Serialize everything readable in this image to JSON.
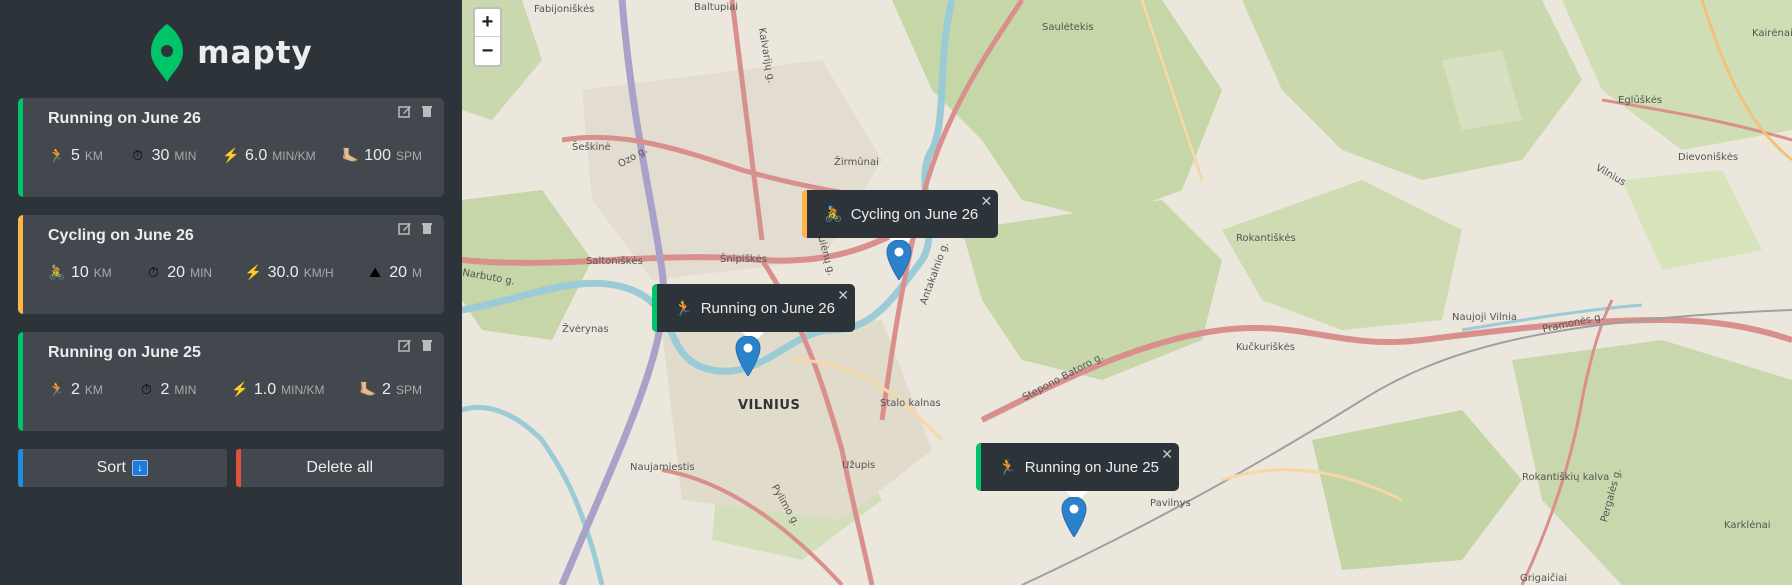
{
  "app": {
    "name": "mapty"
  },
  "workouts": [
    {
      "type": "running",
      "title": "Running on June 26",
      "details": [
        {
          "icon": "🏃",
          "value": "5",
          "unit": "km"
        },
        {
          "icon": "⏱",
          "value": "30",
          "unit": "min"
        },
        {
          "icon": "⚡️",
          "value": "6.0",
          "unit": "min/km"
        },
        {
          "icon": "🦶🏼",
          "value": "100",
          "unit": "spm"
        }
      ]
    },
    {
      "type": "cycling",
      "title": "Cycling on June 26",
      "details": [
        {
          "icon": "🚴",
          "value": "10",
          "unit": "km"
        },
        {
          "icon": "⏱",
          "value": "20",
          "unit": "min"
        },
        {
          "icon": "⚡️",
          "value": "30.0",
          "unit": "km/h"
        },
        {
          "icon": "⛰",
          "value": "20",
          "unit": "m"
        }
      ]
    },
    {
      "type": "running",
      "title": "Running on June 25",
      "details": [
        {
          "icon": "🏃",
          "value": "2",
          "unit": "km"
        },
        {
          "icon": "⏱",
          "value": "2",
          "unit": "min"
        },
        {
          "icon": "⚡️",
          "value": "1.0",
          "unit": "min/km"
        },
        {
          "icon": "🦶🏼",
          "value": "2",
          "unit": "spm"
        }
      ]
    }
  ],
  "controls": {
    "sort_label": "Sort",
    "sort_icon": "↓",
    "delete_label": "Delete all"
  },
  "map": {
    "zoom_in": "+",
    "zoom_out": "−",
    "popups": [
      {
        "type": "cycling",
        "icon": "🚴",
        "text": "Cycling on June 26",
        "close": "✕"
      },
      {
        "type": "running",
        "icon": "🏃",
        "text": "Running on June 26",
        "close": "✕"
      },
      {
        "type": "running",
        "icon": "🏃",
        "text": "Running on June 25",
        "close": "✕"
      }
    ],
    "labels": {
      "city": "VILNIUS",
      "fabijoniskes": "Fabijoniškės",
      "baltupiai": "Baltupiai",
      "sauletekis": "Saulėtekis",
      "karveliai": "Kairėnai",
      "egliskes": "Eglūškės",
      "dievoniskes": "Dievoniškės",
      "seskine": "Šeškinė",
      "zirmunai": "Žirmūnai",
      "snipiskes": "Šnipiškės",
      "saltoniskes": "Saltoniškės",
      "zverynas": "Žvėrynas",
      "rokantiskes": "Rokantiškės",
      "naujoji_vilnia": "Naujoji Vilnia",
      "kucuriskes": "Kučkuriškės",
      "staro_kalnas": "Stalo kalnas",
      "uzupis": "Užupis",
      "naujamiestis": "Naujamiestis",
      "rokantiskiu_kalva": "Rokantiškių kalva",
      "karklenai": "Karklėnai",
      "grigaiciai": "Grigaičiai",
      "pavilnys": "Pavilnys",
      "ozo": "Ozo g.",
      "narbuto": "Narbuto g.",
      "kalvariju": "Kalvarijų g.",
      "stepono_batoro": "Stepono Batoro g.",
      "pramones": "Pramonės g.",
      "antakalnio": "Antakalnio g.",
      "tuskulenu": "Tuskulėnų g.",
      "pylimo": "Pylimo g.",
      "vilnius_road": "Vilnius",
      "pergales": "Pergalės g."
    }
  }
}
